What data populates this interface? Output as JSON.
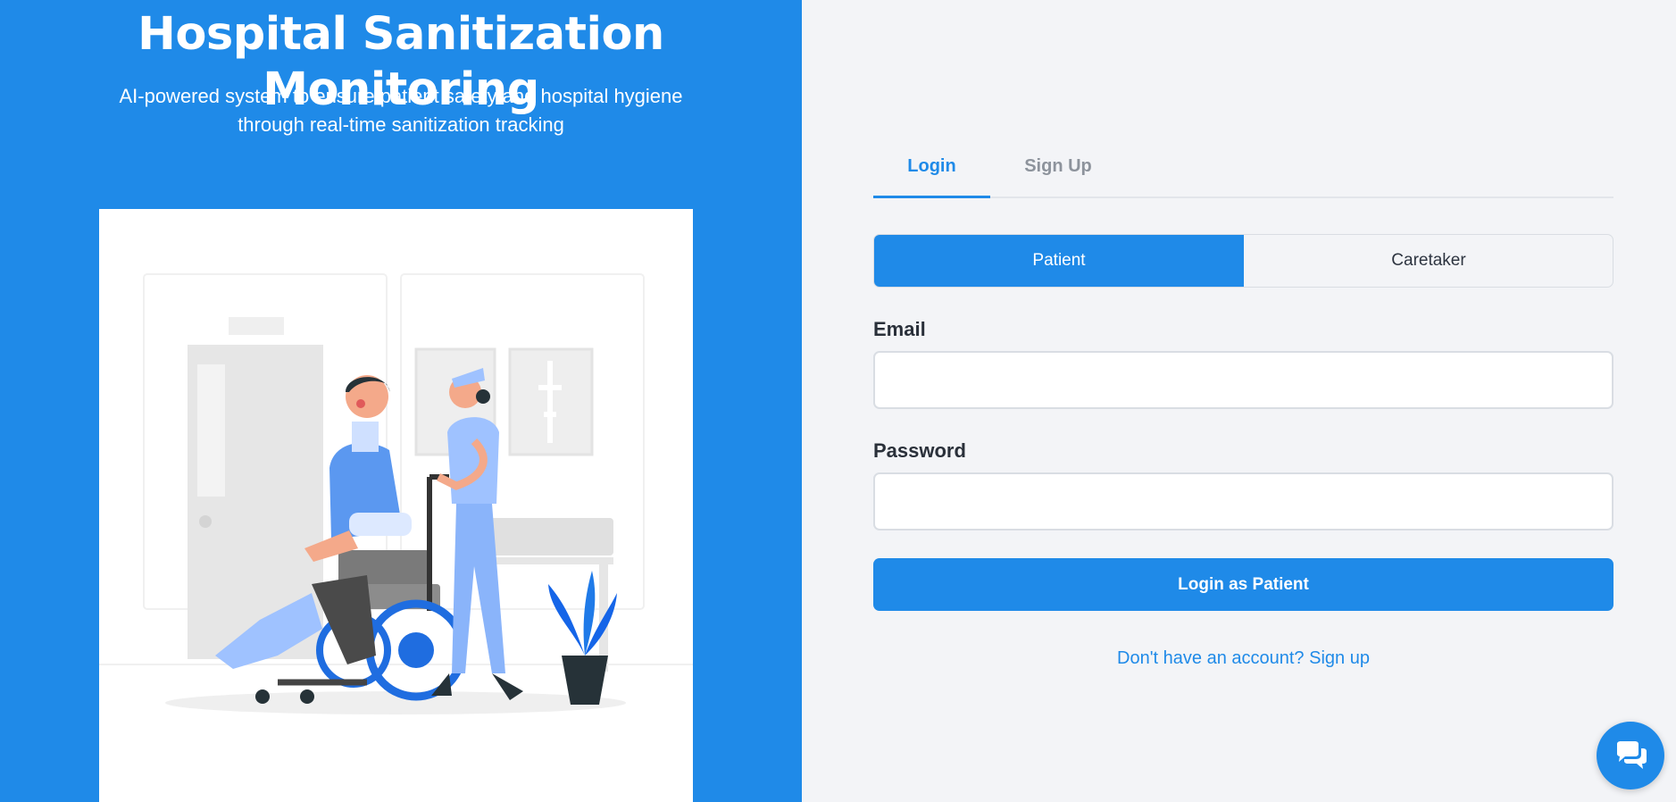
{
  "hero": {
    "title": "Hospital Sanitization Monitoring",
    "subtitle": "AI-powered system to ensure patient safety and hospital hygiene through real-time sanitization tracking",
    "illustration": "patient-in-wheelchair-with-nurse-illustration"
  },
  "auth": {
    "tabs": [
      {
        "label": "Login",
        "active": true
      },
      {
        "label": "Sign Up",
        "active": false
      }
    ],
    "roles": [
      {
        "label": "Patient",
        "selected": true
      },
      {
        "label": "Caretaker",
        "selected": false
      }
    ],
    "email": {
      "label": "Email",
      "value": "",
      "placeholder": ""
    },
    "password": {
      "label": "Password",
      "value": "",
      "placeholder": ""
    },
    "submit_label": "Login as Patient",
    "signup_link": "Don't have an account? Sign up"
  },
  "chat": {
    "icon": "chat-bubbles-icon"
  },
  "colors": {
    "primary": "#1f8ae8",
    "background": "#f3f4f7",
    "text": "#2a303a",
    "muted": "#8d939c"
  }
}
